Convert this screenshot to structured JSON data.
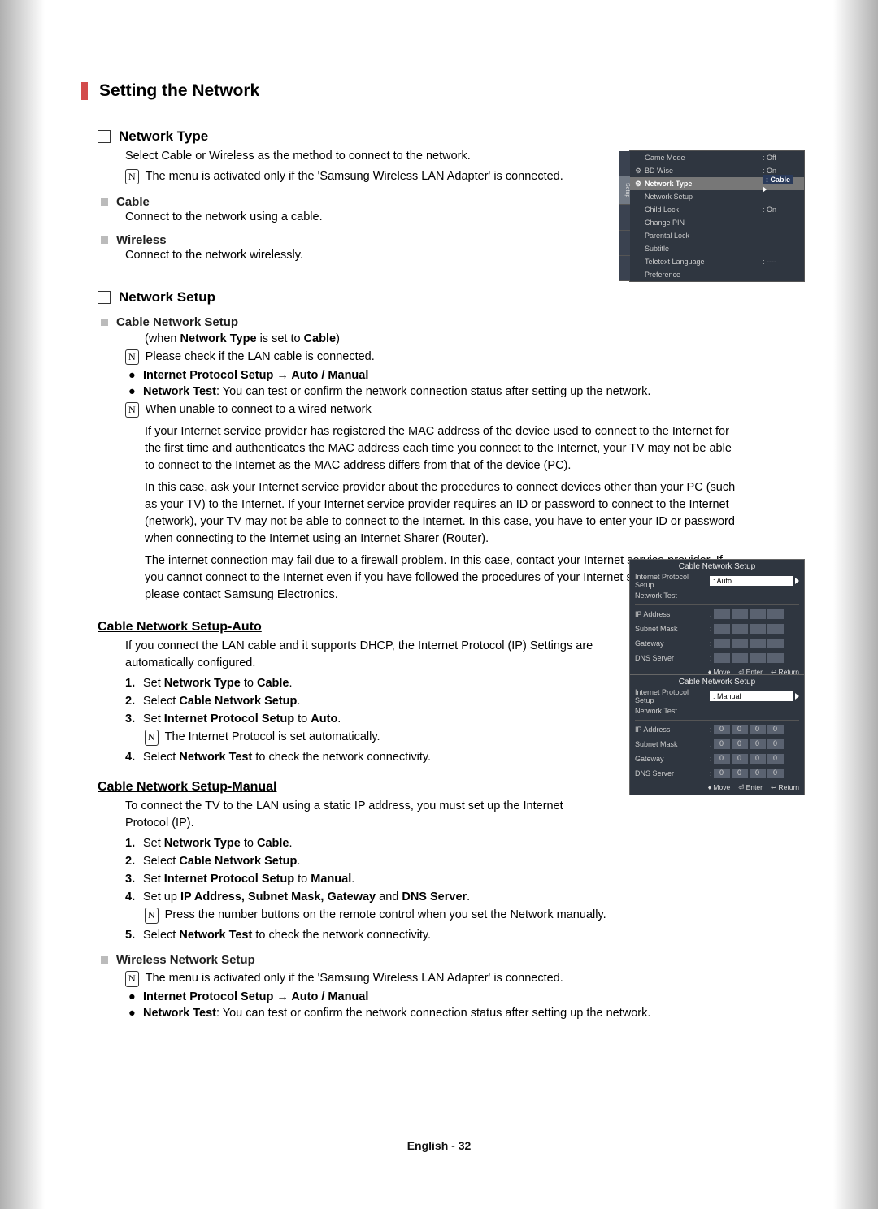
{
  "title": "Setting the Network",
  "s1": {
    "h": "Network Type",
    "p": "Select Cable or Wireless as the method to connect to the network.",
    "note": "The menu is activated only if the 'Samsung Wireless LAN Adapter' is connected.",
    "cable_h": "Cable",
    "cable_p": "Connect to the network using a cable.",
    "wireless_h": "Wireless",
    "wireless_p": "Connect to the network wirelessly."
  },
  "s2": {
    "h": "Network Setup",
    "cable_h": "Cable Network Setup",
    "when_pre": "(when ",
    "when_nt": "Network Type",
    "when_mid": " is set to ",
    "when_cable": "Cable",
    "when_post": ")",
    "note_lan": "Please check if the LAN cable is connected.",
    "bul1": "Internet Protocol Setup → Auto / Manual",
    "bul2a": "Network Test",
    "bul2b": ": You can test or confirm the network connection status after setting up the network.",
    "note_unable": "When unable to connect to a wired network",
    "para1": "If your Internet service provider has registered the MAC address of the device used to connect to the Internet for the first time and authenticates the MAC address each time you connect to the Internet, your TV may not be able to connect to the Internet as the MAC address differs from that of the device (PC).",
    "para2": "In this case, ask your Internet service provider about the procedures to connect devices other than your PC (such as your TV) to the Internet. If your Internet service provider requires an ID or password to connect to the Internet (network), your TV may not be able to connect to the Internet. In this case, you have to enter your ID or password when connecting to the Internet using an Internet Sharer (Router).",
    "para3": "The internet connection may fail due to a firewall problem. In this case, contact your Internet service provider. If you cannot connect to the Internet even if you have followed the procedures of your Internet service provider, please contact Samsung Electronics."
  },
  "s3": {
    "h": "Cable Network Setup-Auto",
    "intro": "If you connect the LAN cable and it supports DHCP, the Internet Protocol (IP) Settings are automatically configured.",
    "n1a": "Set ",
    "n1b": "Network Type",
    "n1c": " to ",
    "n1d": "Cable",
    "n1e": ".",
    "n2a": "Select ",
    "n2b": "Cable Network Setup",
    "n2c": ".",
    "n3a": "Set ",
    "n3b": "Internet Protocol Setup",
    "n3c": " to ",
    "n3d": "Auto",
    "n3e": ".",
    "n3note": "The Internet Protocol is set automatically.",
    "n4a": "Select ",
    "n4b": "Network Test",
    "n4c": " to check the network connectivity."
  },
  "s4": {
    "h": "Cable Network Setup-Manual",
    "intro": "To connect the TV to the LAN using a static IP address, you must set up the Internet Protocol (IP).",
    "n1a": "Set ",
    "n1b": "Network Type",
    "n1c": " to ",
    "n1d": "Cable",
    "n1e": ".",
    "n2a": "Select ",
    "n2b": "Cable Network Setup",
    "n2c": ".",
    "n3a": "Set ",
    "n3b": "Internet Protocol Setup",
    "n3c": " to ",
    "n3d": "Manual",
    "n3e": ".",
    "n4a": "Set up ",
    "n4b": "IP Address, Subnet Mask, Gateway",
    "n4c": " and ",
    "n4d": "DNS Server",
    "n4e": ".",
    "n4note": "Press the number buttons on the remote control when you set the Network manually.",
    "n5a": "Select ",
    "n5b": "Network Test",
    "n5c": " to check the network connectivity."
  },
  "s5": {
    "h": "Wireless Network Setup",
    "note": "The menu is activated only if the 'Samsung Wireless LAN Adapter' is connected.",
    "bul1": "Internet Protocol Setup → Auto / Manual",
    "bul2a": "Network Test",
    "bul2b": ": You can test or confirm the network connection status after setting up the network."
  },
  "osd_menu": {
    "setup_tab": "Setup",
    "game_mode": "Game Mode",
    "game_mode_v": ": Off",
    "bd_wise": "BD Wise",
    "bd_wise_v": ": On",
    "network_type": "Network Type",
    "network_type_v": ": Cable",
    "network_setup": "Network Setup",
    "child_lock": "Child Lock",
    "child_lock_v": ": On",
    "change_pin": "Change PIN",
    "parental_lock": "Parental Lock",
    "subtitle": "Subtitle",
    "teletext_lang": "Teletext Language",
    "teletext_lang_v": ": ----",
    "preference": "Preference"
  },
  "osd_cable": {
    "title": "Cable Network Setup",
    "ips": "Internet Protocol Setup",
    "auto": ": Auto",
    "manual": ": Manual",
    "ntest": "Network Test",
    "ip": "IP Address",
    "mask": "Subnet Mask",
    "gw": "Gateway",
    "dns": "DNS Server",
    "zero": "0",
    "foot_move": "Move",
    "foot_enter": "Enter",
    "foot_return": "Return"
  },
  "footer": {
    "lang": "English",
    "sep": " - ",
    "page": "32"
  },
  "note_glyph": "N"
}
